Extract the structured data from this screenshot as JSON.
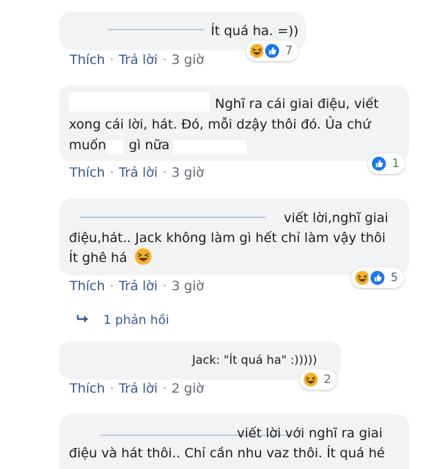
{
  "comments": [
    {
      "text_lines": [
        "Ít quá ha. =))"
      ],
      "actions": {
        "like": "Thích",
        "reply": "Trả lời",
        "time": "3 giờ"
      },
      "reactions": {
        "icons": [
          "haha-icon",
          "like-icon"
        ],
        "count": "7"
      }
    },
    {
      "text_lines": [
        "Nghĩ ra cái giai điệu, viết",
        "xong cái lời, hát. Đó, mỗi dzậy thôi đó. Ủa chứ",
        "muốn",
        "gì nữa"
      ],
      "actions": {
        "like": "Thích",
        "reply": "Trả lời",
        "time": "3 giờ"
      },
      "reactions": {
        "icons": [
          "like-icon"
        ],
        "count": "1"
      }
    },
    {
      "text_lines": [
        "viết lời,nghĩ giai",
        "điệu,hát.. Jack không làm gì hết chỉ làm vậy thôi",
        "Ít ghê há"
      ],
      "actions": {
        "like": "Thích",
        "reply": "Trả lời",
        "time": "3 giờ"
      },
      "reactions": {
        "icons": [
          "haha-icon",
          "like-icon"
        ],
        "count": "5"
      },
      "replies_label": "1 phản hồi"
    },
    {
      "text_lines": [
        "Jack: \"Ít quá ha\" :)))))"
      ],
      "actions": {
        "like": "Thích",
        "reply": "Trả lời",
        "time": "2 giờ"
      },
      "reactions": {
        "icons": [
          "haha-icon"
        ],
        "count": "2"
      }
    },
    {
      "text_lines": [
        "viết lời với nghĩ ra giai",
        "điệu và hát thôi.. Chỉ cần nhu vaz thôi. Ít quá hé"
      ]
    }
  ],
  "colors": {
    "link": "#385898",
    "bubble": "#f2f3f5",
    "like": "#1877f2",
    "haha": "#f7b125"
  }
}
